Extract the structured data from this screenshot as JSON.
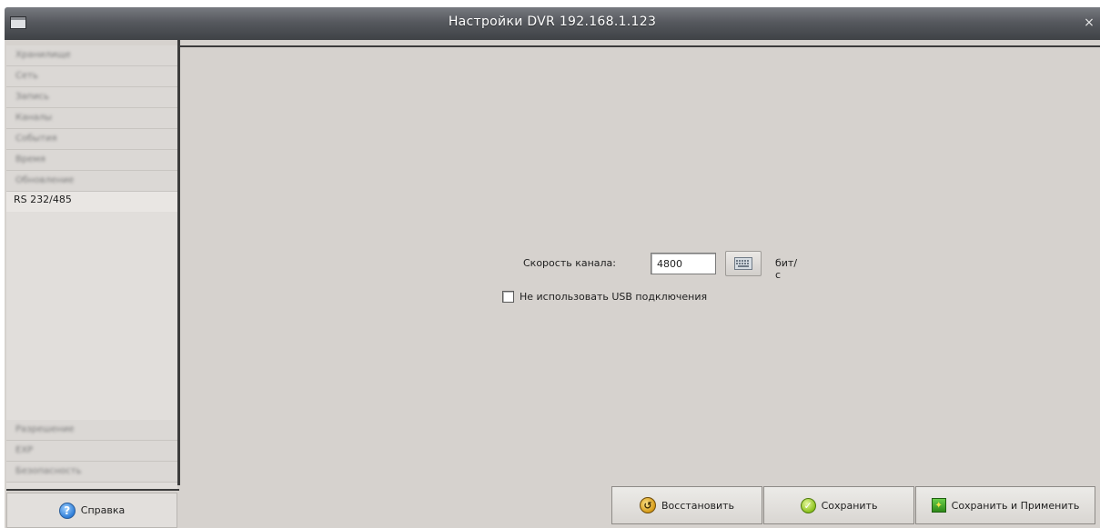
{
  "window": {
    "title": "Настройки DVR 192.168.1.123",
    "close_glyph": "×"
  },
  "sidebar": {
    "items": [
      {
        "label": "Хранилище"
      },
      {
        "label": "Сеть"
      },
      {
        "label": "Запись"
      },
      {
        "label": "Каналы"
      },
      {
        "label": "События"
      },
      {
        "label": "Время"
      },
      {
        "label": "Обновление"
      },
      {
        "label": "RS 232/485",
        "active": true
      }
    ],
    "bottom_items": [
      {
        "label": "Разрешение"
      },
      {
        "label": "EXP"
      },
      {
        "label": "Безопасность"
      }
    ]
  },
  "help": {
    "label": "Справка",
    "icon": "help-icon"
  },
  "form": {
    "speed_label": "Скорость канала:",
    "speed_value": "4800",
    "unit": "бит/с",
    "usb_checkbox_label": "Не использовать USB подключения",
    "usb_checked": false
  },
  "buttons": {
    "restore": "Восстановить",
    "save": "Сохранить",
    "save_apply": "Сохранить и Применить"
  }
}
